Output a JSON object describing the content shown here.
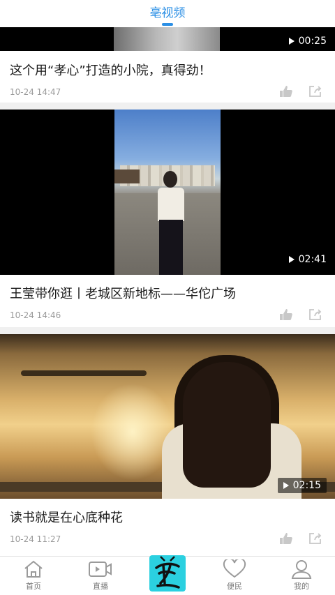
{
  "header": {
    "title": "亳视频"
  },
  "videos": [
    {
      "duration": "00:25",
      "title": "这个用“孝心”打造的小院，真得劲！",
      "time": "10-24 14:47"
    },
    {
      "duration": "02:41",
      "title": "王莹带你逛丨老城区新地标——华佗广场",
      "time": "10-24 14:46"
    },
    {
      "duration": "02:15",
      "title": "读书就是在心底种花",
      "time": "10-24 11:27"
    }
  ],
  "tabbar": {
    "items": [
      {
        "label": "首页",
        "icon": "home-icon"
      },
      {
        "label": "直播",
        "icon": "live-video-icon"
      },
      {
        "label": "",
        "icon": "app-logo"
      },
      {
        "label": "便民",
        "icon": "heart-icon"
      },
      {
        "label": "我的",
        "icon": "user-icon"
      }
    ]
  },
  "colors": {
    "accent": "#2b8fe5",
    "logo_bg": "#2bd0e0"
  }
}
